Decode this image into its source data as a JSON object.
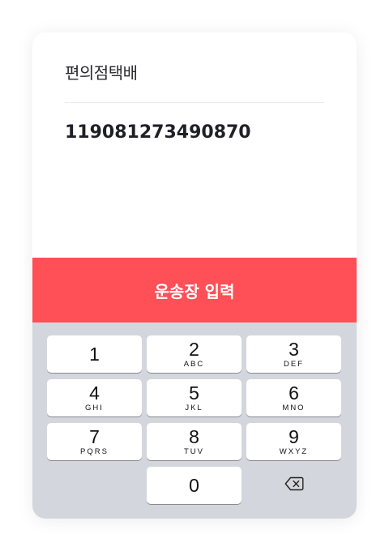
{
  "carrier": "편의점택배",
  "tracking_number": "119081273490870",
  "submit_label": "운송장 입력",
  "keys": [
    {
      "num": "1",
      "letters": ""
    },
    {
      "num": "2",
      "letters": "ABC"
    },
    {
      "num": "3",
      "letters": "DEF"
    },
    {
      "num": "4",
      "letters": "GHI"
    },
    {
      "num": "5",
      "letters": "JKL"
    },
    {
      "num": "6",
      "letters": "MNO"
    },
    {
      "num": "7",
      "letters": "PQRS"
    },
    {
      "num": "8",
      "letters": "TUV"
    },
    {
      "num": "9",
      "letters": "WXYZ"
    },
    {
      "num": "0",
      "letters": ""
    }
  ],
  "icons": {
    "backspace": "backspace-icon"
  },
  "colors": {
    "accent": "#ff4f57",
    "keypad_bg": "#d3d6dc",
    "key_bg": "#ffffff"
  }
}
